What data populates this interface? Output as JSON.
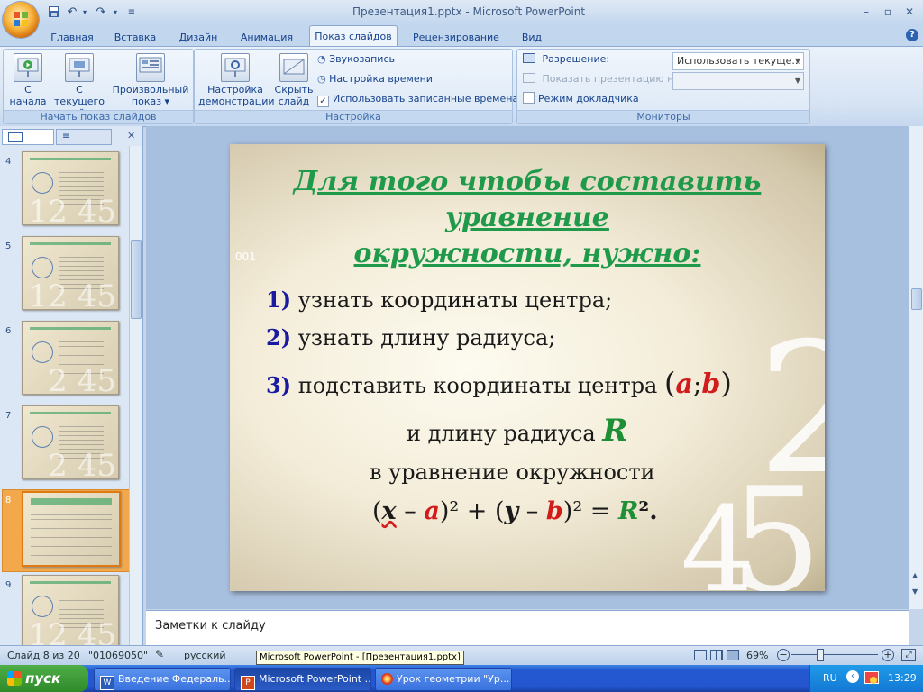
{
  "window": {
    "title": "Презентация1.pptx - Microsoft PowerPoint"
  },
  "quick_access": {
    "icons": [
      "save-icon",
      "undo-icon",
      "redo-icon",
      "customize-icon"
    ]
  },
  "tabs": [
    "Главная",
    "Вставка",
    "Дизайн",
    "Анимация",
    "Показ слайдов",
    "Рецензирование",
    "Вид"
  ],
  "active_tab": "Показ слайдов",
  "ribbon": {
    "start_group": {
      "label": "Начать показ слайдов",
      "btn_start": {
        "line1": "С",
        "line2": "начала"
      },
      "btn_current": {
        "line1": "С текущего",
        "line2": "слайда"
      },
      "btn_custom": {
        "line1": "Произвольный",
        "line2": "показ ▾"
      }
    },
    "setup_group": {
      "label": "Настройка",
      "btn_setup": {
        "line1": "Настройка",
        "line2": "демонстрации"
      },
      "btn_hide": {
        "line1": "Скрыть",
        "line2": "слайд"
      },
      "record": "Звукозапись",
      "timing": "Настройка времени",
      "use_timings": "Использовать записанные времена"
    },
    "monitors_group": {
      "label": "Мониторы",
      "resolution_label": "Разрешение:",
      "resolution_value": "Использовать текуще...",
      "show_on_label": "Показать презентацию на:",
      "show_on_value": "",
      "presenter_view": "Режим докладчика"
    }
  },
  "thumbnails": [
    {
      "num": "4",
      "title": "1 этап: Вывод формулы",
      "big": "12 45"
    },
    {
      "num": "5",
      "title": "Вывод формулы",
      "big": "12 45"
    },
    {
      "num": "6",
      "title": "Формула I",
      "big": "2 45"
    },
    {
      "num": "7",
      "title": "Формула II",
      "big": "2 45"
    },
    {
      "num": "8",
      "title": "Для того чтобы составить уравнение окружности, нужно:",
      "big": ""
    },
    {
      "num": "9",
      "title": "№1. Составить уравнение окружности",
      "big": "12 45"
    }
  ],
  "slide": {
    "title_line1": "Для того чтобы составить",
    "title_line2": "уравнение",
    "title_line3": "окружности, нужно:",
    "ghost_code": "001",
    "step1_num": "1)",
    "step1_text": "узнать координаты центра;",
    "step2_num": "2)",
    "step2_text": "узнать длину радиуса;",
    "step3_num": "3)",
    "step3_text": "подставить координаты центра",
    "coord_open": "(",
    "coord_a": "a",
    "coord_sep": ";",
    "coord_b": "b",
    "coord_close": ")",
    "line4_text": "и длину радиуса",
    "line4_r": "R",
    "line5_text": "в уравнение окружности",
    "eq_p1": "(",
    "eq_x": "x",
    "eq_minus1": " – ",
    "eq_a": "a",
    "eq_p2": ")² + (",
    "eq_y": "y",
    "eq_minus2": " – ",
    "eq_b": "b",
    "eq_p3": ")² = ",
    "eq_R": "R",
    "eq_end": "².",
    "ghost_digits": {
      "d2": "2",
      "d4": "4",
      "d5": "5"
    }
  },
  "notes": {
    "placeholder": "Заметки к слайду"
  },
  "status": {
    "slide_info": "Слайд 8 из 20",
    "theme": "\"01069050\"",
    "language": "русский",
    "zoom": "69%"
  },
  "tooltip": "Microsoft PowerPoint - [Презентация1.pptx]",
  "taskbar": {
    "start": "пуск",
    "tasks": [
      "Введение Федераль...",
      "Microsoft PowerPoint ...",
      "Урок геометрии \"Ур..."
    ],
    "lang": "RU",
    "clock": "13:29"
  },
  "colors": {
    "title_green": "#1f9a4b",
    "number_blue": "#1a1aa0",
    "accent_red": "#d21c1c",
    "accent_green": "#1e8f35"
  }
}
